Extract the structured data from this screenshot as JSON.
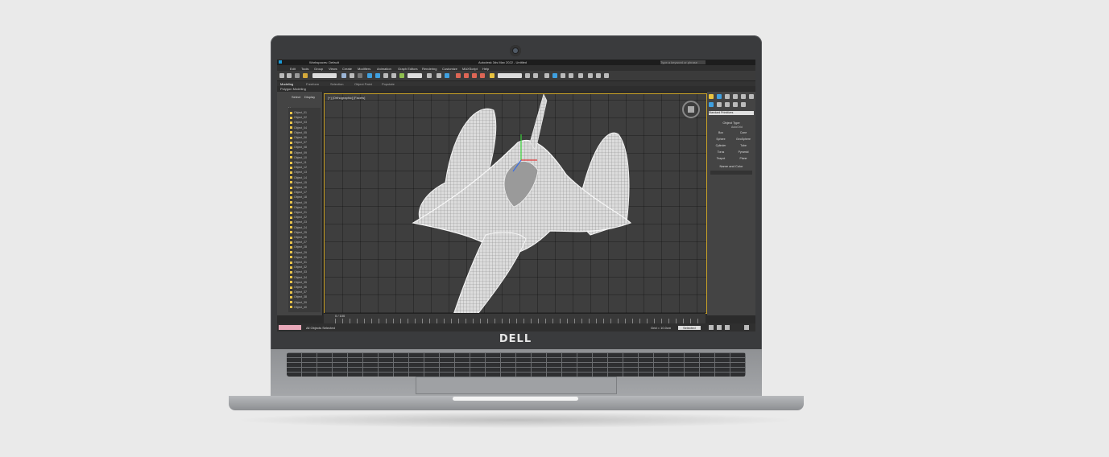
{
  "brand": "DELL",
  "app": {
    "workspace_label": "Workspaces: Default",
    "title": "Autodesk 3ds Max 2022 - Untitled",
    "search_placeholder": "Type a keyword or phrase",
    "menu": [
      "Edit",
      "Tools",
      "Group",
      "Views",
      "Create",
      "Modifiers",
      "Animation",
      "Graph Editors",
      "Rendering",
      "Customize",
      "MAXScript",
      "Help"
    ],
    "ribbon_tabs": [
      "Modeling",
      "Freeform",
      "Selection",
      "Object Paint",
      "Populate"
    ],
    "ribbon_sub": "Polygon Modeling",
    "scene_tabs": [
      "Select",
      "Display"
    ],
    "scene_header": "Name",
    "scene_items": [
      "Object_01",
      "Object_02",
      "Object_03",
      "Object_04",
      "Object_05",
      "Object_06",
      "Object_07",
      "Object_08",
      "Object_09",
      "Object_10",
      "Object_11",
      "Object_12",
      "Object_13",
      "Object_14",
      "Object_15",
      "Object_16",
      "Object_17",
      "Object_18",
      "Object_19",
      "Object_20",
      "Object_21",
      "Object_22",
      "Object_23",
      "Object_24",
      "Object_25",
      "Object_26",
      "Object_27",
      "Object_28",
      "Object_29",
      "Object_30",
      "Object_31",
      "Object_32",
      "Object_33",
      "Object_34",
      "Object_35",
      "Object_36",
      "Object_37",
      "Object_38",
      "Object_39",
      "Object_40"
    ],
    "viewport_label": "[+] [Orthographic] [Facets]",
    "command_panel": {
      "dropdown": "Standard Primitives",
      "rollout_object_type": "Object Type",
      "autogrid": "AutoGrid",
      "buttons": [
        "Box",
        "Cone",
        "Sphere",
        "GeoSphere",
        "Cylinder",
        "Tube",
        "Torus",
        "Pyramid",
        "Teapot",
        "Plane"
      ],
      "rollout_name_color": "Name and Color"
    },
    "timeline_counter": "0 / 100",
    "status_selected": "All Objects Selected",
    "grid_text": "Grid = 10.0cm",
    "selected_label": "Selected",
    "accent": "#c9a227"
  }
}
